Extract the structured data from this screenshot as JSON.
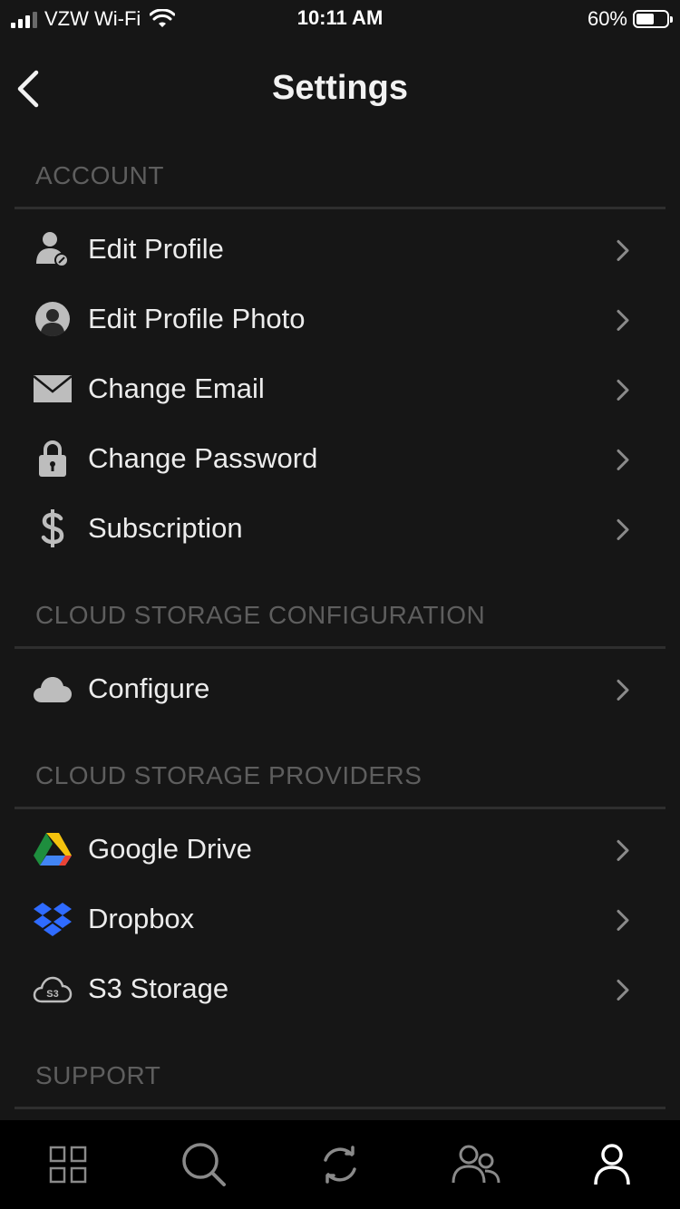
{
  "status_bar": {
    "carrier": "VZW Wi-Fi",
    "time": "10:11 AM",
    "battery": "60%",
    "battery_level": 0.6
  },
  "nav": {
    "title": "Settings",
    "back_icon": "chevron-left-icon"
  },
  "sections": {
    "account": {
      "header": "ACCOUNT",
      "items": [
        {
          "label": "Edit Profile",
          "icon": "user-edit-icon"
        },
        {
          "label": "Edit Profile Photo",
          "icon": "profile-photo-icon"
        },
        {
          "label": "Change Email",
          "icon": "envelope-icon"
        },
        {
          "label": "Change Password",
          "icon": "lock-icon"
        },
        {
          "label": "Subscription",
          "icon": "dollar-icon"
        }
      ]
    },
    "cloud_config": {
      "header": "CLOUD STORAGE CONFIGURATION",
      "items": [
        {
          "label": "Configure",
          "icon": "cloud-icon"
        }
      ]
    },
    "providers": {
      "header": "CLOUD STORAGE PROVIDERS",
      "items": [
        {
          "label": "Google Drive",
          "icon": "google-drive-icon"
        },
        {
          "label": "Dropbox",
          "icon": "dropbox-icon"
        },
        {
          "label": "S3 Storage",
          "icon": "s3-cloud-icon",
          "icon_text": "S3"
        }
      ]
    },
    "support": {
      "header": "SUPPORT"
    }
  },
  "tab_bar": {
    "tabs": [
      {
        "icon": "grid-icon",
        "active": false
      },
      {
        "icon": "search-icon",
        "active": false
      },
      {
        "icon": "sync-icon",
        "active": false
      },
      {
        "icon": "people-icon",
        "active": false
      },
      {
        "icon": "profile-icon",
        "active": true
      }
    ]
  },
  "colors": {
    "background": "#161616",
    "section_header": "#5e5e5e",
    "text": "#ececec",
    "tab_bar": "#000000",
    "tab_inactive": "#8a8a8a",
    "tab_active": "#ffffff"
  }
}
